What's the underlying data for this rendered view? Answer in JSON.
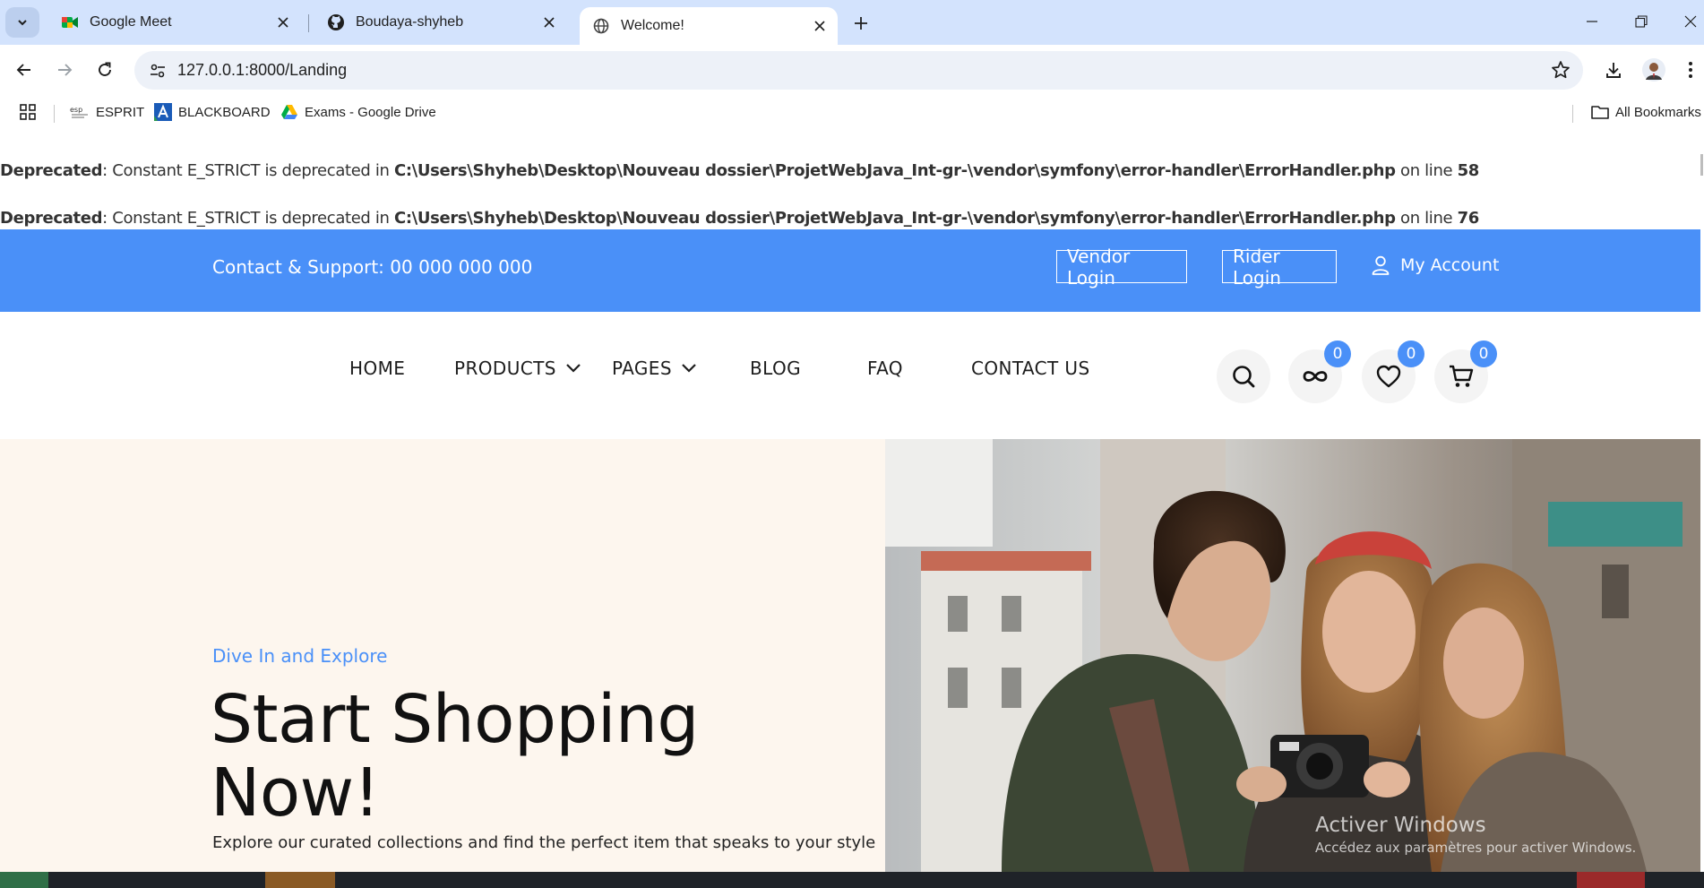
{
  "browser": {
    "tabs": [
      {
        "title": "Google Meet",
        "icon": "google-meet-icon"
      },
      {
        "title": "Boudaya-shyheb",
        "icon": "github-icon"
      },
      {
        "title": "Welcome!",
        "icon": "globe-icon",
        "active": true
      }
    ],
    "url": "127.0.0.1:8000/Landing",
    "bookmarks": [
      {
        "label": "ESPRIT",
        "icon": "esprit-icon"
      },
      {
        "label": "BLACKBOARD",
        "icon": "blackboard-icon"
      },
      {
        "label": "Exams - Google Drive",
        "icon": "google-drive-icon"
      }
    ],
    "all_bookmarks": "All Bookmarks"
  },
  "deprecations": [
    {
      "label": "Deprecated",
      "message": ": Constant E_STRICT is deprecated in ",
      "path": "C:\\Users\\Shyheb\\Desktop\\Nouveau dossier\\ProjetWebJava_Int-gr-\\vendor\\symfony\\error-handler\\ErrorHandler.php",
      "on_line": " on line ",
      "line": "58"
    },
    {
      "label": "Deprecated",
      "message": ": Constant E_STRICT is deprecated in ",
      "path": "C:\\Users\\Shyheb\\Desktop\\Nouveau dossier\\ProjetWebJava_Int-gr-\\vendor\\symfony\\error-handler\\ErrorHandler.php",
      "on_line": " on line ",
      "line": "76"
    }
  ],
  "topbar": {
    "support": "Contact & Support: 00 000 000 000",
    "vendor_login": "Vendor Login",
    "rider_login": "Rider Login",
    "my_account": "My Account"
  },
  "nav": {
    "links": [
      "HOME",
      "PRODUCTS",
      "PAGES",
      "BLOG",
      "FAQ",
      "CONTACT US"
    ],
    "counts": {
      "compare": "0",
      "wishlist": "0",
      "cart": "0"
    }
  },
  "hero": {
    "kicker": "Dive In and Explore",
    "title_line1": "Start Shopping",
    "title_line2": "Now!",
    "description": "Explore our curated collections and find the perfect item that speaks to your style"
  },
  "watermark": {
    "title": "Activer Windows",
    "subtitle": "Accédez aux paramètres pour activer Windows."
  },
  "colors": {
    "accent": "#4a90f8",
    "hero_bg": "#fdf6ee",
    "chrome_tabstrip": "#d3e3fd"
  }
}
